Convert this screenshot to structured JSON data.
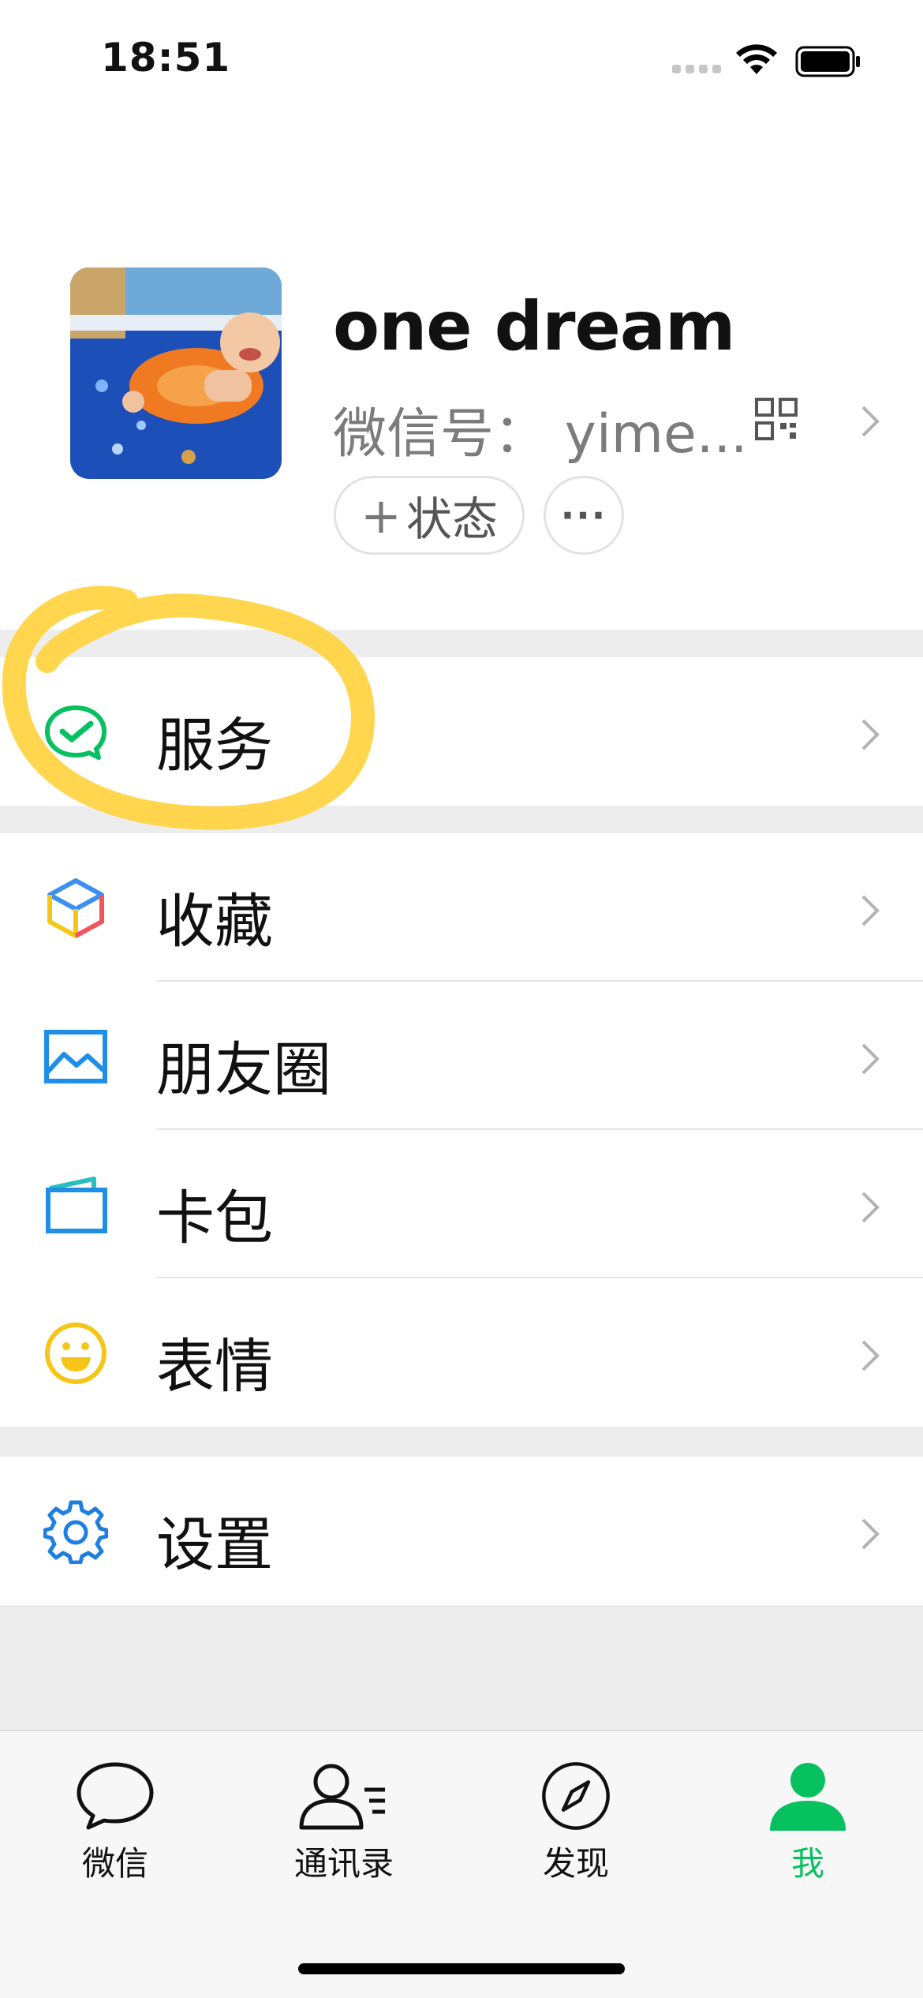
{
  "status_bar": {
    "time": "18:51"
  },
  "profile": {
    "name": "one dream",
    "wechat_id": "微信号：  yime...",
    "status_button": "状态",
    "status_button_plus": "+",
    "more_button": "···"
  },
  "menu": {
    "services": "服务",
    "favorites": "收藏",
    "moments": "朋友圈",
    "cards": "卡包",
    "stickers": "表情",
    "settings": "设置"
  },
  "tabbar": {
    "chats": "微信",
    "contacts": "通讯录",
    "discover": "发现",
    "me": "我"
  },
  "colors": {
    "accent": "#07c160",
    "highlight": "#ffd23a",
    "favorites_blue": "#3d8ff0",
    "moments_blue": "#1f8ee6",
    "stickers_yellow": "#f5c518",
    "settings_blue": "#1f7fe0"
  },
  "icons": {
    "services": "wechat-pay-check-icon",
    "favorites": "cube-icon",
    "moments": "picture-icon",
    "cards": "wallet-icon",
    "stickers": "smiley-icon",
    "settings": "gear-icon"
  }
}
